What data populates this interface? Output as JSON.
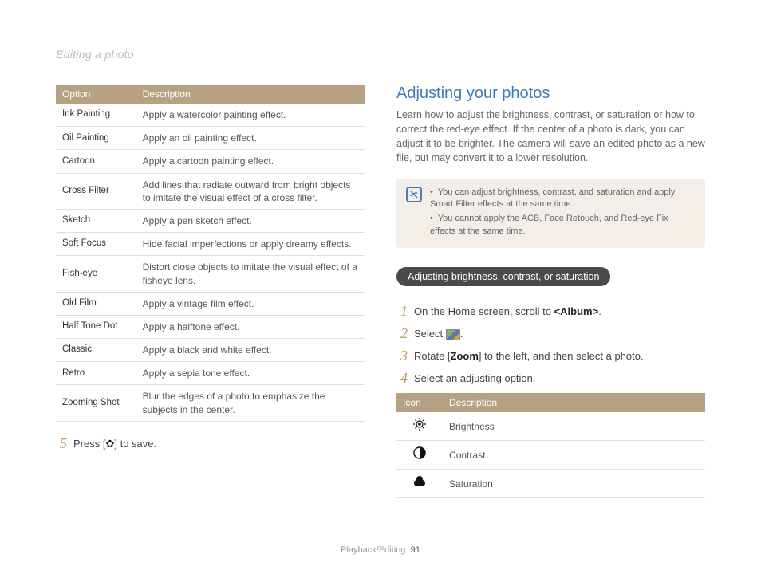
{
  "header": "Editing a photo",
  "options_table": {
    "headers": [
      "Option",
      "Description"
    ],
    "rows": [
      {
        "opt": "Ink Painting",
        "desc": "Apply a watercolor painting effect."
      },
      {
        "opt": "Oil Painting",
        "desc": "Apply an oil painting effect."
      },
      {
        "opt": "Cartoon",
        "desc": "Apply a cartoon painting effect."
      },
      {
        "opt": "Cross Filter",
        "desc": "Add lines that radiate outward from bright objects to imitate the visual effect of a cross filter."
      },
      {
        "opt": "Sketch",
        "desc": "Apply a pen sketch effect."
      },
      {
        "opt": "Soft Focus",
        "desc": "Hide facial imperfections or apply dreamy effects."
      },
      {
        "opt": "Fish-eye",
        "desc": "Distort close objects to imitate the visual effect of a fisheye lens."
      },
      {
        "opt": "Old Film",
        "desc": "Apply a vintage film effect."
      },
      {
        "opt": "Half Tone Dot",
        "desc": "Apply a halftone effect."
      },
      {
        "opt": "Classic",
        "desc": "Apply a black and white effect."
      },
      {
        "opt": "Retro",
        "desc": "Apply a sepia tone effect."
      },
      {
        "opt": "Zooming Shot",
        "desc": "Blur the edges of a photo to emphasize the subjects in the center."
      }
    ]
  },
  "left_step": {
    "num": "5",
    "pre": "Press [",
    "post": "] to save."
  },
  "right": {
    "title": "Adjusting your photos",
    "intro": "Learn how to adjust the brightness, contrast, or saturation or how to correct the red-eye effect. If the center of a photo is dark, you can adjust it to be brighter. The camera will save an edited photo as a new file, but may convert it to a lower resolution.",
    "notes": [
      "You can adjust brightness, contrast, and saturation and apply Smart Filter effects at the same time.",
      "You cannot apply the ACB, Face Retouch, and Red-eye Fix effects at the same time."
    ],
    "pill": "Adjusting brightness, contrast, or saturation",
    "steps": [
      {
        "num": "1",
        "html_parts": [
          "On the Home screen, scroll to ",
          "<Album>",
          "."
        ]
      },
      {
        "num": "2",
        "html_parts": [
          "Select ",
          "PHOTO_ICON",
          "."
        ]
      },
      {
        "num": "3",
        "html_parts": [
          "Rotate [",
          "Zoom",
          "] to the left, and then select a photo."
        ]
      },
      {
        "num": "4",
        "html_parts": [
          "Select an adjusting option."
        ]
      }
    ],
    "icon_table": {
      "headers": [
        "Icon",
        "Description"
      ],
      "rows": [
        {
          "icon": "brightness",
          "desc": "Brightness"
        },
        {
          "icon": "contrast",
          "desc": "Contrast"
        },
        {
          "icon": "saturation",
          "desc": "Saturation"
        }
      ]
    }
  },
  "footer": {
    "section": "Playback/Editing",
    "page": "91"
  },
  "chart_data": {
    "type": "table",
    "options_effects": [
      [
        "Ink Painting",
        "Apply a watercolor painting effect."
      ],
      [
        "Oil Painting",
        "Apply an oil painting effect."
      ],
      [
        "Cartoon",
        "Apply a cartoon painting effect."
      ],
      [
        "Cross Filter",
        "Add lines that radiate outward from bright objects to imitate the visual effect of a cross filter."
      ],
      [
        "Sketch",
        "Apply a pen sketch effect."
      ],
      [
        "Soft Focus",
        "Hide facial imperfections or apply dreamy effects."
      ],
      [
        "Fish-eye",
        "Distort close objects to imitate the visual effect of a fisheye lens."
      ],
      [
        "Old Film",
        "Apply a vintage film effect."
      ],
      [
        "Half Tone Dot",
        "Apply a halftone effect."
      ],
      [
        "Classic",
        "Apply a black and white effect."
      ],
      [
        "Retro",
        "Apply a sepia tone effect."
      ],
      [
        "Zooming Shot",
        "Blur the edges of a photo to emphasize the subjects in the center."
      ]
    ],
    "adjust_icons": [
      [
        "Brightness"
      ],
      [
        "Contrast"
      ],
      [
        "Saturation"
      ]
    ]
  }
}
